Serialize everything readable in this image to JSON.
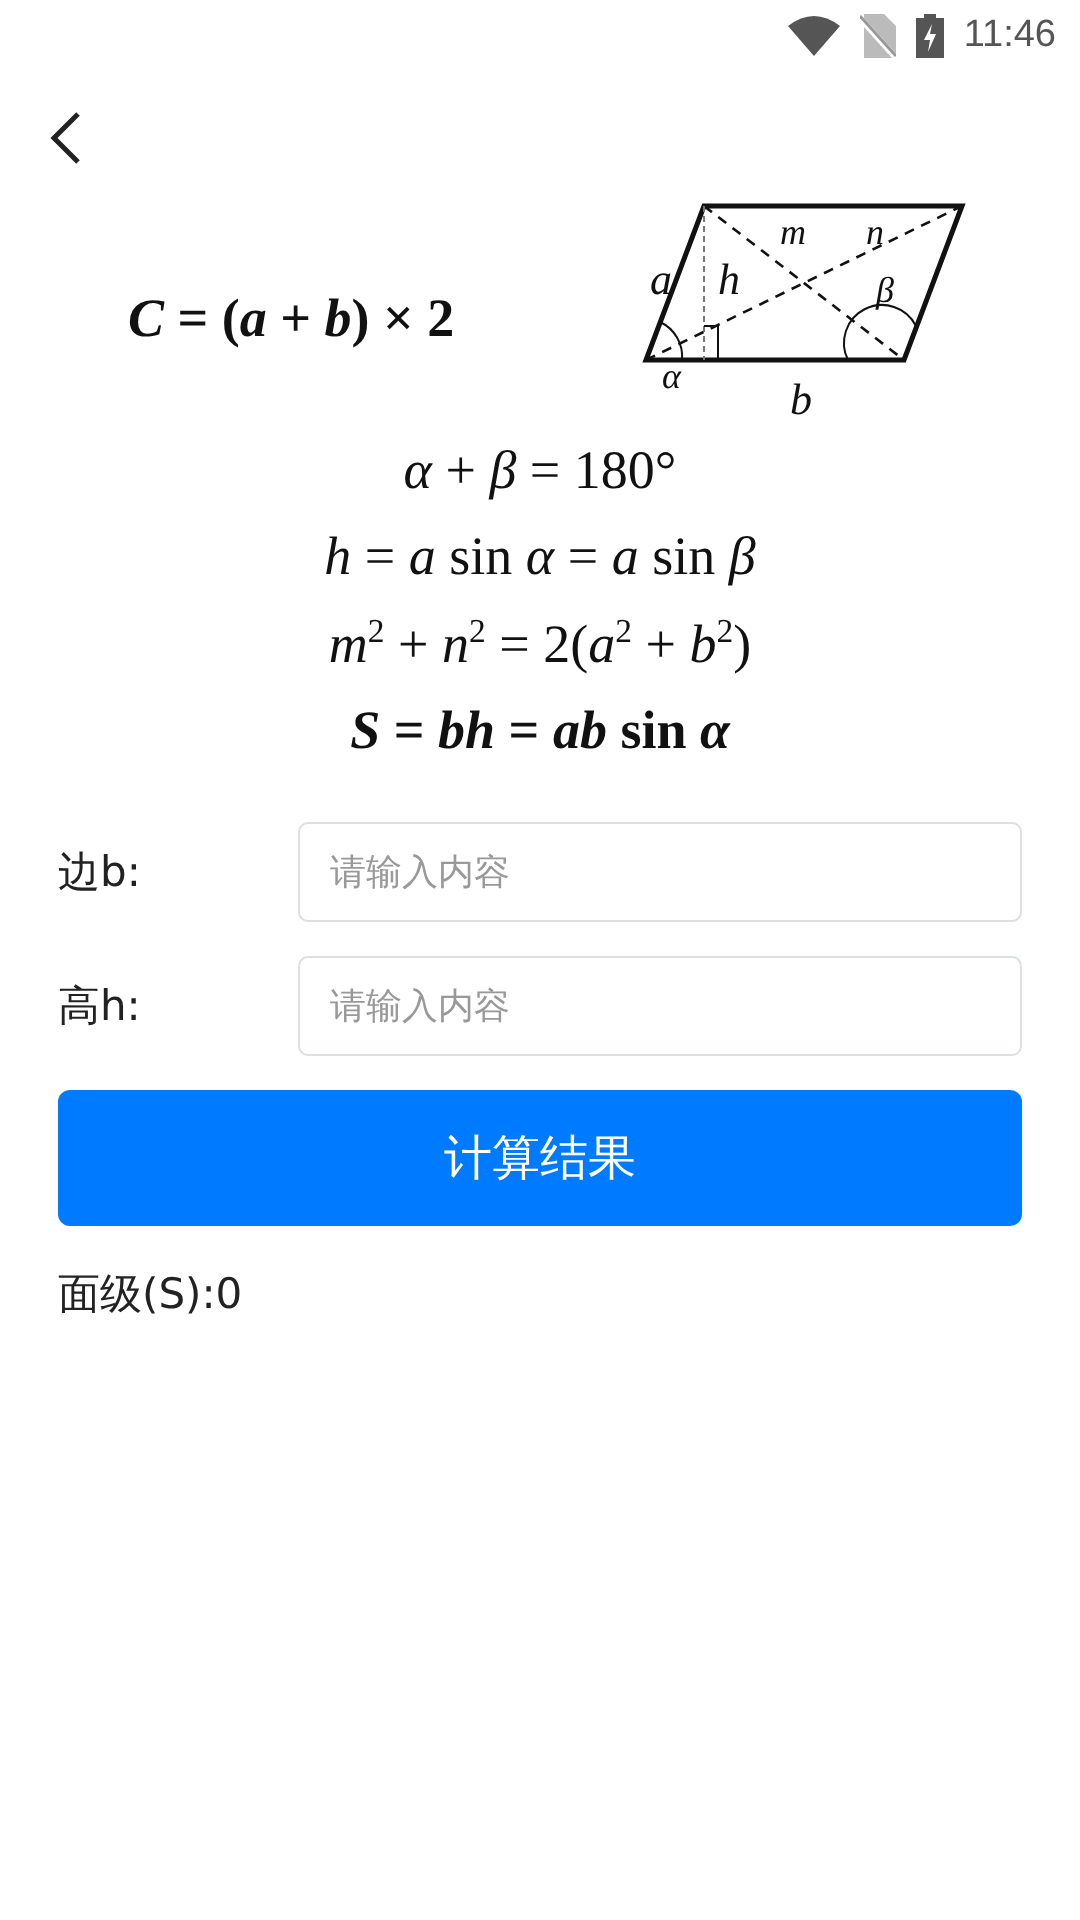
{
  "status_bar": {
    "time": "11:46"
  },
  "perimeter_formula": {
    "text": "*C* = (*a* + *b*) × 2",
    "bold": true
  },
  "diagram": {
    "labels": [
      "a",
      "h",
      "m",
      "n",
      "β",
      "α",
      "b"
    ]
  },
  "formulas": [
    {
      "text": "*α* + *β* = 180°",
      "bold": false
    },
    {
      "text": "*h* = *a* sin *α* = *a* sin *β*",
      "bold": false
    },
    {
      "text": "*m*$^{2}$ + *n*$^{2}$ = 2(*a*$^{2}$ + *b*$^{2}$)",
      "bold": false
    },
    {
      "text": "*S* = *bh* = *ab* sin *α*",
      "bold": true
    }
  ],
  "fields": [
    {
      "label": "边b:",
      "placeholder": "请输入内容"
    },
    {
      "label": "高h:",
      "placeholder": "请输入内容"
    }
  ],
  "button": "计算结果",
  "result": "面级(S):0"
}
